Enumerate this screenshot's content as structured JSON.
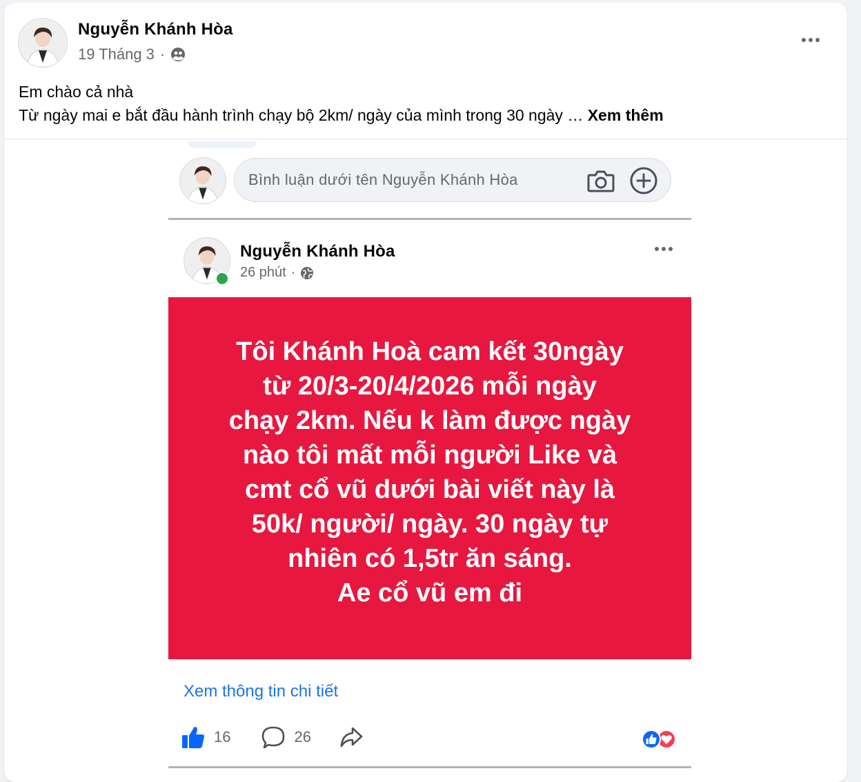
{
  "post": {
    "author": "Nguyễn Khánh Hòa",
    "date": "19 Tháng 3",
    "separator": "·",
    "privacy_icon": "friends-icon",
    "text_line1": "Em chào cả nhà",
    "text_line2": "Từ ngày mai e bắt đầu hành trình chạy bộ 2km/ ngày của mình trong 30 ngày …",
    "see_more": "Xem thêm"
  },
  "embedded": {
    "comment_placeholder": "Bình luận dưới tên Nguyễn Khánh Hòa",
    "author": "Nguyễn Khánh Hòa",
    "time": "26 phút",
    "separator": "·",
    "privacy_icon": "globe-icon",
    "card_lines": [
      "Tôi Khánh Hoà cam kết 30ngày",
      "từ 20/3-20/4/2026 mỗi ngày",
      "chạy 2km. Nếu k làm được ngày",
      "nào tôi mất mỗi người Like và",
      "cmt cổ vũ dưới bài viết này là",
      "50k/ người/ ngày. 30 ngày tự",
      "nhiên có 1,5tr ăn sáng.",
      "Ae cổ vũ em đi"
    ],
    "details_link": "Xem thông tin chi tiết",
    "like_count": "16",
    "comment_count": "26",
    "reactions": [
      "like",
      "love"
    ]
  },
  "colors": {
    "card_red": "#e8173f",
    "link_blue": "#1b74e4",
    "like_blue": "#0866ff",
    "online_green": "#31a24c"
  }
}
